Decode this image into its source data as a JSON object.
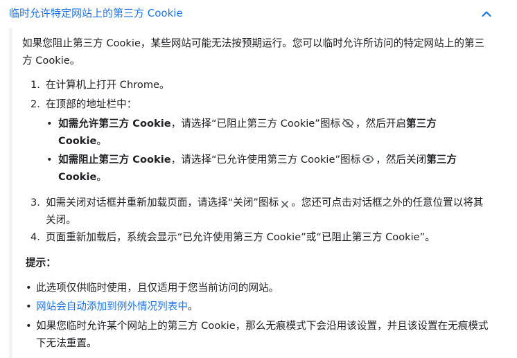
{
  "header": {
    "title": "临时允许特定网站上的第三方 Cookie",
    "expanded": true,
    "title_color": "#1a73e8"
  },
  "intro": "如果您阻止第三方 Cookie，某些网站可能无法按预期运行。您可以临时允许所访问的特定网站上的第三方 Cookie。",
  "steps": [
    {
      "num": "1.",
      "text": "在计算机上打开 Chrome。"
    },
    {
      "num": "2.",
      "text": "在顶部的地址栏中："
    },
    {
      "num": "3.",
      "text_before": "如需关闭对话框并重新加载页面，请选择“关闭”图标",
      "icon": "close-icon",
      "text_after": "。您还可点击对话框之外的任意位置以将其关闭。"
    },
    {
      "num": "4.",
      "text": "页面重新加载后，系统会显示“已允许使用第三方 Cookie”或“已阻止第三方 Cookie”。"
    }
  ],
  "substeps": [
    {
      "bold_lead": "如需允许第三方 Cookie",
      "middle": "，请选择“已阻止第三方 Cookie”图标",
      "icon": "eye-off-icon",
      "after": "，然后开启",
      "bold_tail": "第三方 Cookie",
      "end": "。"
    },
    {
      "bold_lead": "如需阻止第三方 Cookie",
      "middle": "，请选择“已允许使用第三方 Cookie”图标",
      "icon": "eye-icon",
      "after": "，然后关闭",
      "bold_tail": "第三方 Cookie",
      "end": "。"
    }
  ],
  "tips": {
    "title": "提示：",
    "items": [
      {
        "text": "此选项仅供临时使用，且仅适用于您当前访问的网站。",
        "is_link": false
      },
      {
        "text": "网站会自动添加到例外情况列表中",
        "is_link": true,
        "suffix": "。"
      },
      {
        "text": "如果您临时允许某个网站上的第三方 Cookie，那么无痕模式下会沿用该设置，并且该设置在无痕模式下无法重置。",
        "is_link": false
      }
    ]
  },
  "colors": {
    "accent": "#1a73e8",
    "text": "#202124",
    "panel_border": "#f1f3f4",
    "icon": "#5f6368"
  },
  "bullet": "•"
}
